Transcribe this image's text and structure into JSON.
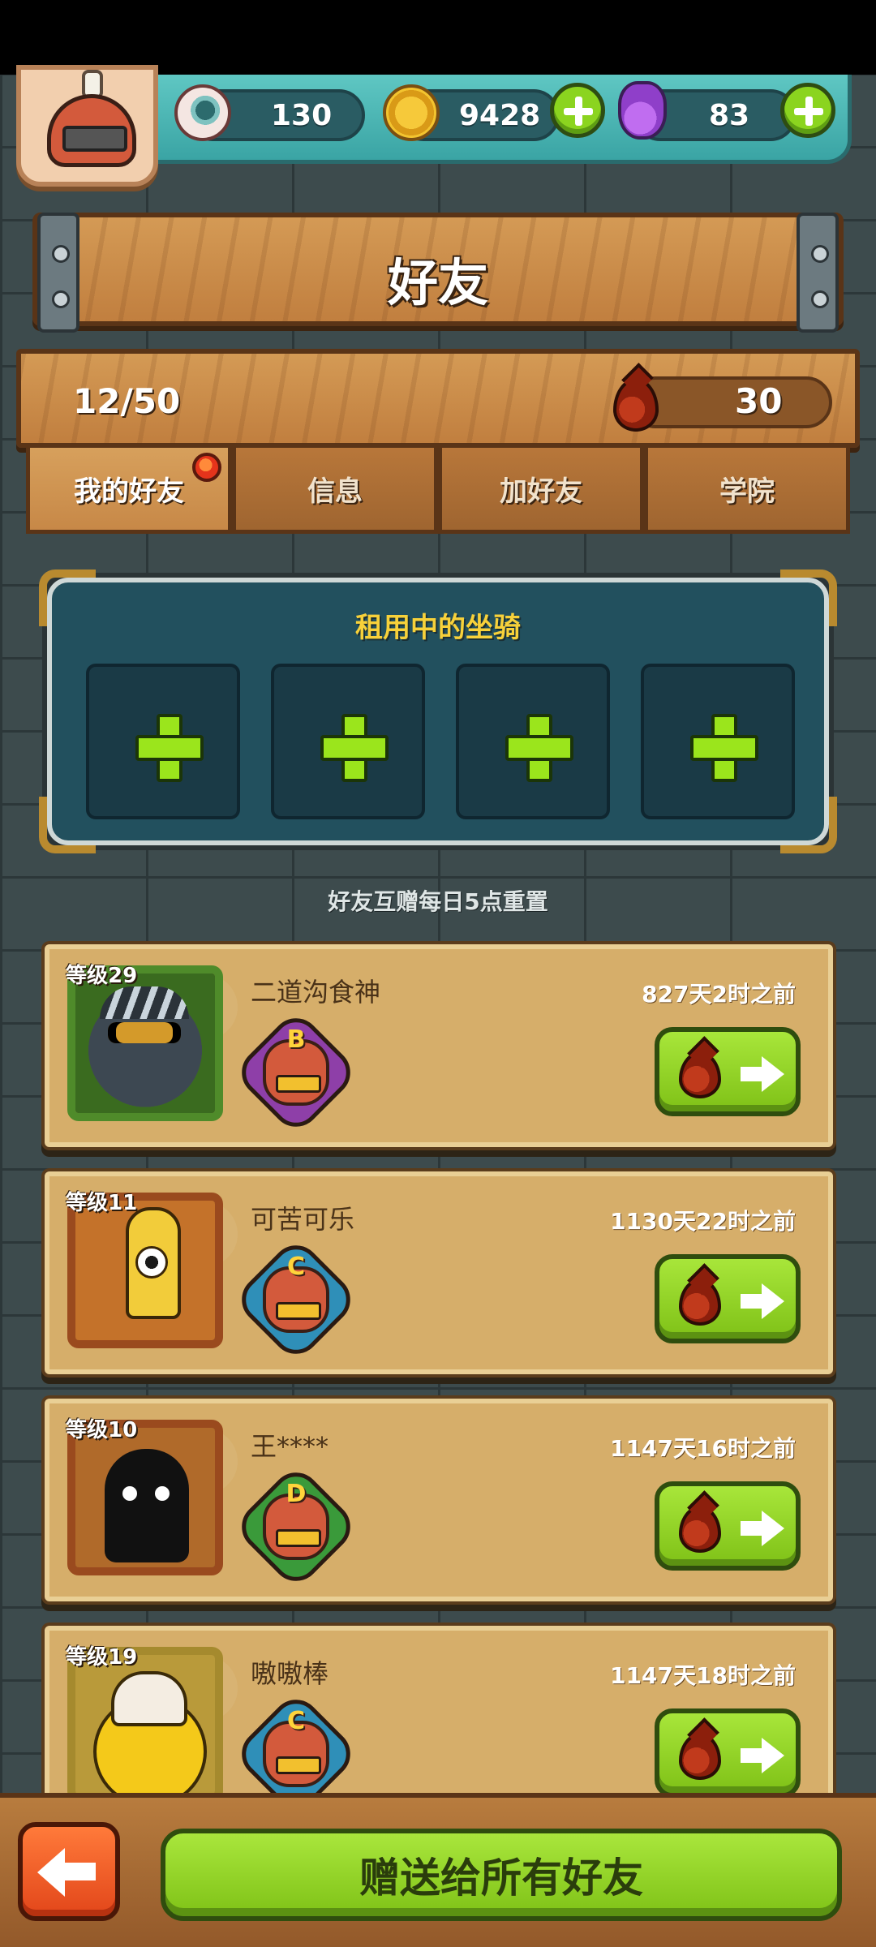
{
  "resources": {
    "eyeballs": "130",
    "coins": "9428",
    "potions": "83"
  },
  "header": {
    "title": "好友"
  },
  "friends_summary": {
    "count": "12/50",
    "blood": "30"
  },
  "tabs": [
    {
      "label": "我的好友",
      "active": true,
      "has_notification": true
    },
    {
      "label": "信息",
      "active": false
    },
    {
      "label": "加好友",
      "active": false
    },
    {
      "label": "学院",
      "active": false
    }
  ],
  "mount_panel": {
    "title": "租用中的坐骑",
    "slots": 4
  },
  "reset_note": "好友互赠每日5点重置",
  "friends": [
    {
      "level": "等级29",
      "name": "二道沟食神",
      "last_seen": "827天2时之前",
      "rank": "B",
      "rank_color": "#8e3fa8",
      "portrait": "ninja"
    },
    {
      "level": "等级11",
      "name": "可苦可乐",
      "last_seen": "1130天22时之前",
      "rank": "C",
      "rank_color": "#2f8fb8",
      "portrait": "squid"
    },
    {
      "level": "等级10",
      "name": "王****",
      "last_seen": "1147天16时之前",
      "rank": "D",
      "rank_color": "#3a9a3a",
      "portrait": "shadow"
    },
    {
      "level": "等级19",
      "name": "嗷嗷棒",
      "last_seen": "1147天18时之前",
      "rank": "C",
      "rank_color": "#2f8fb8",
      "portrait": "chick"
    }
  ],
  "bottom": {
    "send_all_label": "赠送给所有好友"
  },
  "colors": {
    "accent_green": "#8bd41f",
    "wood": "#c98b48",
    "panel": "#22505e"
  }
}
